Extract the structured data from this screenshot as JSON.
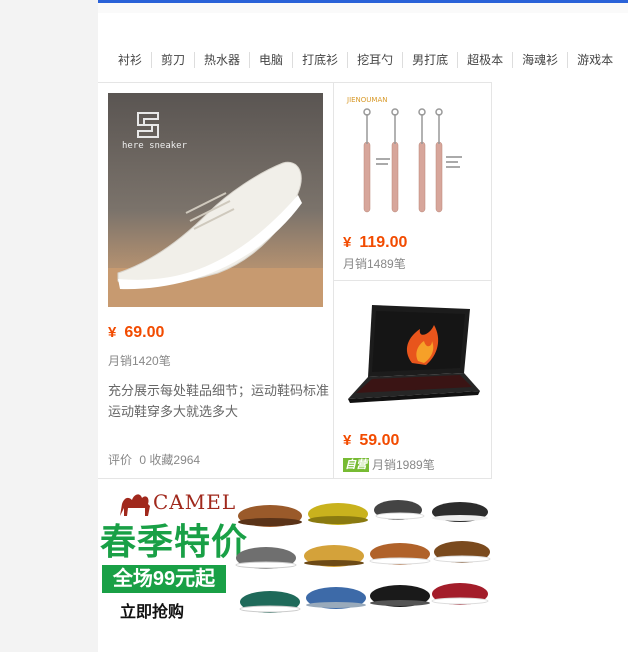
{
  "nav": {
    "categories": [
      "衬衫",
      "剪刀",
      "热水器",
      "电脑",
      "打底衫",
      "挖耳勺",
      "男打底",
      "超极本",
      "海魂衫",
      "游戏本"
    ]
  },
  "products": [
    {
      "image_text": "here sneaker",
      "currency": "¥",
      "price": "69.00",
      "sales": "月销1420笔",
      "description": "充分展示每处鞋品细节；运动鞋码标准运动鞋穿多大就选多大",
      "reviews_label": "评价",
      "reviews_count": "0",
      "favorites": "收藏2964"
    },
    {
      "image_brand": "JIENOUMAN",
      "currency": "¥",
      "price": "119.00",
      "sales": "月销1489笔"
    },
    {
      "currency": "¥",
      "price": "59.00",
      "tag": "自营",
      "sales": "月销1989笔"
    }
  ],
  "banner": {
    "brand": "CAMEL",
    "slogan": "春季特价",
    "sale": "全场99元起",
    "cta": "立即抢购"
  },
  "colors": {
    "accent_bar": "#2a62d8",
    "price": "#f24b00",
    "banner_green": "#19a046",
    "brand_red": "#a0281c"
  }
}
